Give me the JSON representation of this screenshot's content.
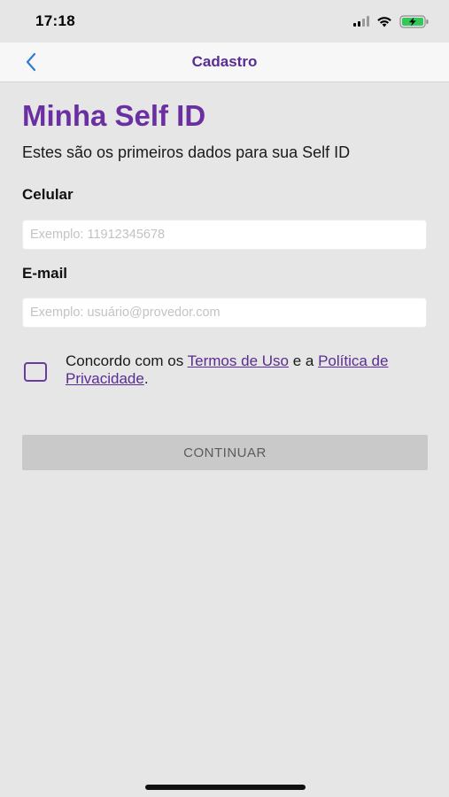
{
  "status_bar": {
    "time": "17:18",
    "icons": [
      "signal-icon",
      "wifi-icon",
      "battery-charging-icon"
    ]
  },
  "nav": {
    "title": "Cadastro",
    "back_icon": "chevron-left-icon"
  },
  "header": {
    "title": "Minha Self ID",
    "subtitle": "Estes são os primeiros dados para sua Self ID"
  },
  "form": {
    "phone": {
      "label": "Celular",
      "placeholder": "Exemplo: 11912345678",
      "value": ""
    },
    "email": {
      "label": "E-mail",
      "placeholder": "Exemplo: usuário@provedor.com",
      "value": ""
    },
    "terms": {
      "checked": false,
      "prefix": "Concordo com os ",
      "terms_link": "Termos de Uso",
      "connector": " e a ",
      "privacy_link": "Política de Privacidade",
      "suffix": "."
    },
    "continue_label": "CONTINUAR"
  },
  "colors": {
    "brand_purple": "#6a2fa0",
    "nav_title": "#5a2d91",
    "back_blue": "#2f7ad6",
    "background": "#e6e6e6",
    "button_disabled": "#c9c9c9",
    "battery_green": "#34c759"
  }
}
